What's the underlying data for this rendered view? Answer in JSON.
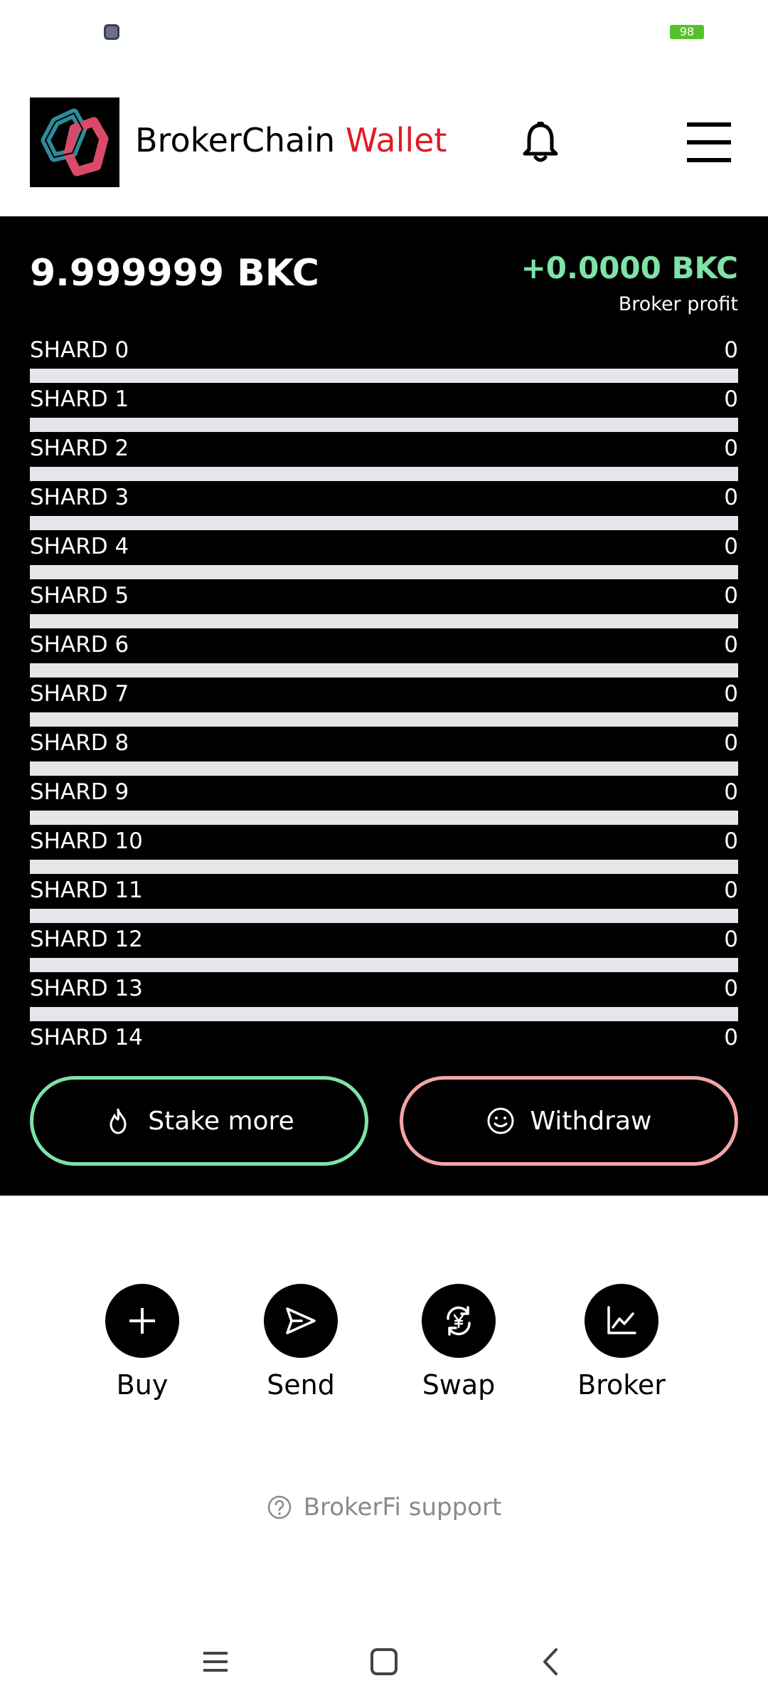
{
  "status_bar": {
    "battery": "98",
    "battery_color": "#55c22b"
  },
  "header": {
    "title_main": "BrokerChain",
    "title_accent": "Wallet",
    "accent_color": "#e01b24",
    "logo_icon": "brokerchain-logo",
    "bell_icon": "bell-icon",
    "menu_icon": "menu-icon"
  },
  "wallet": {
    "balance": "9.999999 BKC",
    "profit": "+0.0000 BKC",
    "profit_label": "Broker profit",
    "profit_color": "#7ee3a6"
  },
  "shards": [
    {
      "name": "SHARD 0",
      "value": "0",
      "progress": 0
    },
    {
      "name": "SHARD 1",
      "value": "0",
      "progress": 0
    },
    {
      "name": "SHARD 2",
      "value": "0",
      "progress": 0
    },
    {
      "name": "SHARD 3",
      "value": "0",
      "progress": 0
    },
    {
      "name": "SHARD 4",
      "value": "0",
      "progress": 0
    },
    {
      "name": "SHARD 5",
      "value": "0",
      "progress": 0
    },
    {
      "name": "SHARD 6",
      "value": "0",
      "progress": 0
    },
    {
      "name": "SHARD 7",
      "value": "0",
      "progress": 0
    },
    {
      "name": "SHARD 8",
      "value": "0",
      "progress": 0
    },
    {
      "name": "SHARD 9",
      "value": "0",
      "progress": 0
    },
    {
      "name": "SHARD 10",
      "value": "0",
      "progress": 0
    },
    {
      "name": "SHARD 11",
      "value": "0",
      "progress": 0
    },
    {
      "name": "SHARD 12",
      "value": "0",
      "progress": 0
    },
    {
      "name": "SHARD 13",
      "value": "0",
      "progress": 0
    },
    {
      "name": "SHARD 14",
      "value": "0",
      "progress": 0
    }
  ],
  "buttons": {
    "stake": {
      "label": "Stake more",
      "icon": "flame-icon",
      "color": "#7ee3a6"
    },
    "withdraw": {
      "label": "Withdraw",
      "icon": "smile-icon",
      "color": "#f4a5a5"
    }
  },
  "actions": [
    {
      "label": "Buy",
      "icon": "plus-icon"
    },
    {
      "label": "Send",
      "icon": "send-icon"
    },
    {
      "label": "Swap",
      "icon": "swap-yen-icon"
    },
    {
      "label": "Broker",
      "icon": "chart-icon"
    }
  ],
  "support": {
    "label": "BrokerFi support",
    "icon": "help-circle-icon"
  },
  "navbar": {
    "icons": [
      "recents-icon",
      "home-icon",
      "back-icon"
    ]
  }
}
